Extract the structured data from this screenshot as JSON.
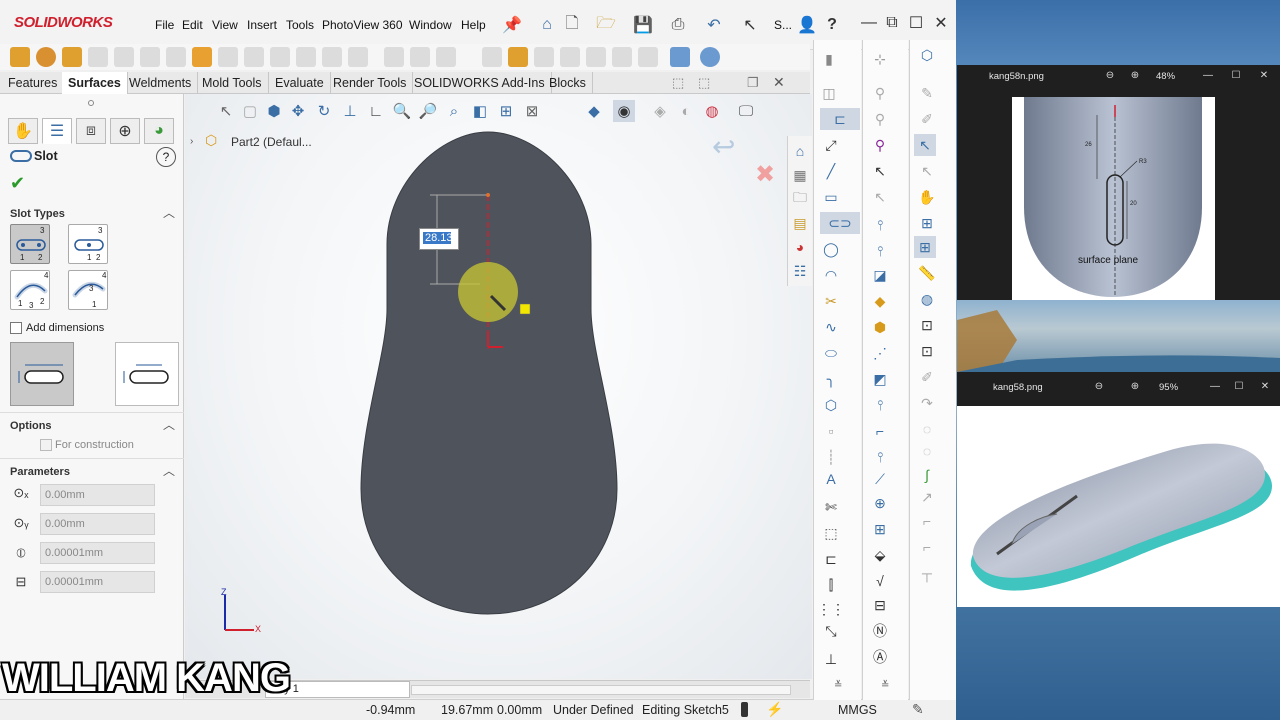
{
  "app": {
    "logo": "SOLIDWORKS",
    "menu": [
      "File",
      "Edit",
      "View",
      "Insert",
      "Tools",
      "PhotoView 360",
      "Window",
      "Help"
    ],
    "search_short": "S...",
    "help_icon": "?"
  },
  "command_tabs": [
    "Features",
    "Surfaces",
    "Weldments",
    "Mold Tools",
    "Evaluate",
    "Render Tools",
    "SOLIDWORKS Add-Ins",
    "Blocks"
  ],
  "active_tab": "Surfaces",
  "property_manager": {
    "title": "Slot",
    "help": "?",
    "sections": {
      "slot_types": "Slot Types",
      "add_dimensions": "Add dimensions",
      "options": "Options",
      "for_construction": "For construction",
      "parameters": "Parameters"
    },
    "slot_type_badges": [
      [
        "3",
        "1",
        "2"
      ],
      [
        "3",
        "1",
        "2"
      ],
      [
        "4",
        "1",
        "3",
        "2"
      ],
      [
        "4",
        "3",
        "1"
      ]
    ],
    "parameters": [
      "0.00mm",
      "0.00mm",
      "0.00001mm",
      "0.00001mm"
    ]
  },
  "feature_tree": {
    "root": "Part2  (Defaul..."
  },
  "dimension_value": "28.13",
  "axes": {
    "z": "Z",
    "x": "X"
  },
  "model_tab_label": "udy 1",
  "status_bar": {
    "x": "-0.94mm",
    "y": "19.67mm",
    "z": "0.00mm",
    "state": "Under Defined",
    "editing": "Editing Sketch5",
    "units": "MMGS"
  },
  "viewer1": {
    "title": "kang58n.png",
    "zoom": "48%",
    "dim_a": "26",
    "dim_b": "R3",
    "dim_c": "20",
    "caption": "surface plane"
  },
  "viewer2": {
    "title": "kang58.png",
    "zoom": "95%"
  },
  "watermark": "WILLIAM KANG",
  "colors": {
    "sketch_body": "#4f535b",
    "accent_red": "#d0202e",
    "teal_band": "#3fc4bf",
    "highlight_yellow": "#c9c733"
  }
}
